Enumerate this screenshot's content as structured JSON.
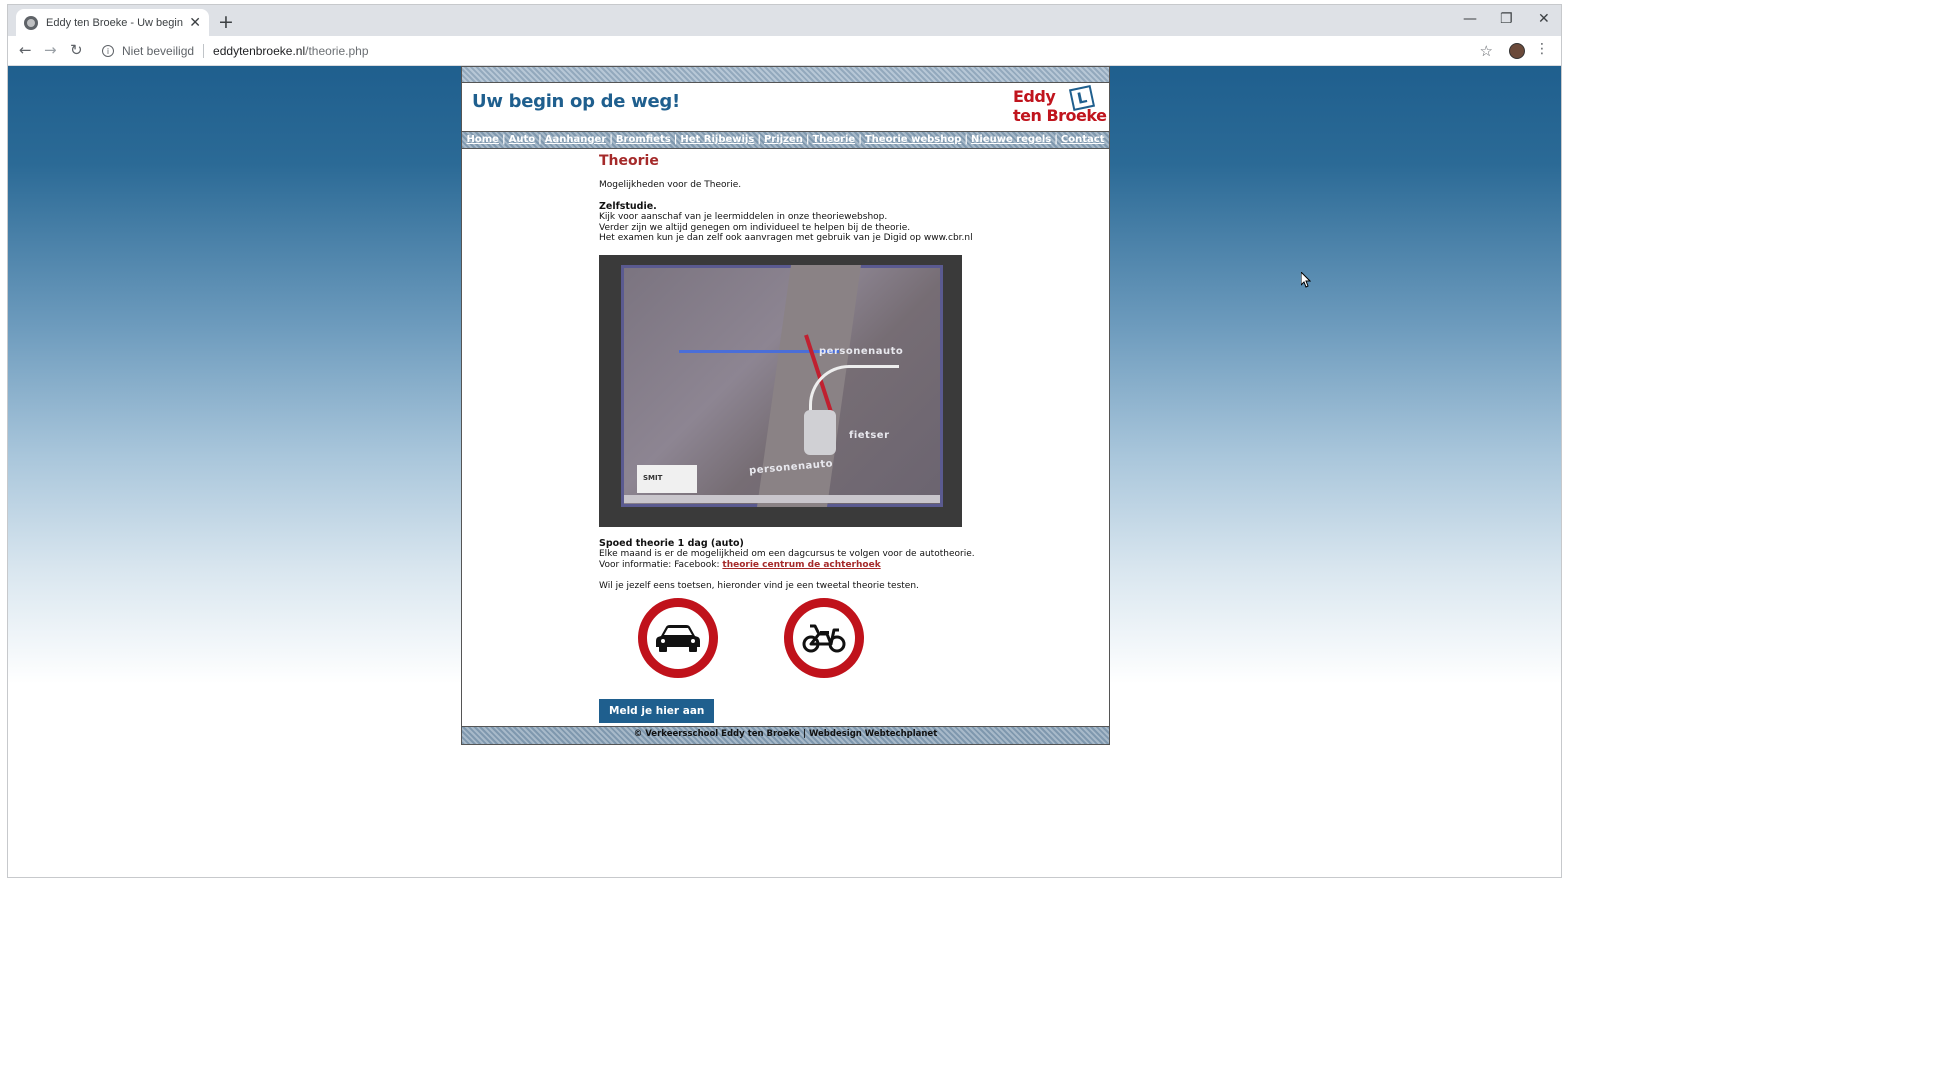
{
  "browser": {
    "tab_title": "Eddy ten Broeke - Uw begin op d",
    "tab_close": "✕",
    "new_tab": "+",
    "security_label": "Niet beveiligd",
    "url_host": "eddytenbroeke.nl",
    "url_path": "/theorie.php",
    "icons": {
      "back": "arrow-left-icon",
      "forward": "arrow-right-icon",
      "reload": "reload-icon",
      "info": "info-icon",
      "bookmark": "star-icon",
      "profile": "avatar",
      "menu": "kebab-menu-icon"
    },
    "window_controls": {
      "minimize": "—",
      "restore": "❐",
      "close": "✕"
    }
  },
  "site": {
    "tagline": "Uw begin op de weg!",
    "logo": {
      "line1": "Eddy",
      "line2": "ten Broeke",
      "badge": "L"
    },
    "nav": [
      "Home",
      "Auto",
      "Aanhanger",
      "Bromfiets",
      "Het Rijbewijs",
      "Prijzen",
      "Theorie",
      "Theorie webshop",
      "Nieuwe regels",
      "Contact"
    ],
    "footer": "© Verkeersschool Eddy ten Broeke | Webdesign Webtechplanet",
    "colors": {
      "brand_blue": "#1f5f8e",
      "brand_red": "#c0141d",
      "heading_red": "#a52a2a"
    }
  },
  "content": {
    "heading": "Theorie",
    "intro": "Mogelijkheden voor de Theorie.",
    "self_study": {
      "title": "Zelfstudie.",
      "lines": [
        "Kijk voor aanschaf van je leermiddelen in onze theoriewebshop.",
        "Verder zijn we altijd genegen om individueel te helpen bij de theorie.",
        "Het examen kun je dan zelf ook aanvragen met gebruik van je Digid op www.cbr.nl"
      ]
    },
    "photo_labels": {
      "car_top": "personenauto",
      "cyclist": "fietser",
      "car_bottom": "personenauto",
      "sticker": "SMIT"
    },
    "speed_course": {
      "title": "Spoed theorie 1 dag (auto)",
      "line1": "Elke maand is er de mogelijkheid om een dagcursus te volgen voor de autotheorie.",
      "info_prefix": "Voor informatie: Facebook: ",
      "info_link": "theorie centrum de achterhoek"
    },
    "tests_intro": "Wil je jezelf eens toetsen, hieronder vind je een tweetal theorie testen.",
    "signs": [
      "car-sign-icon",
      "moped-sign-icon"
    ],
    "cta": "Meld je hier aan"
  }
}
